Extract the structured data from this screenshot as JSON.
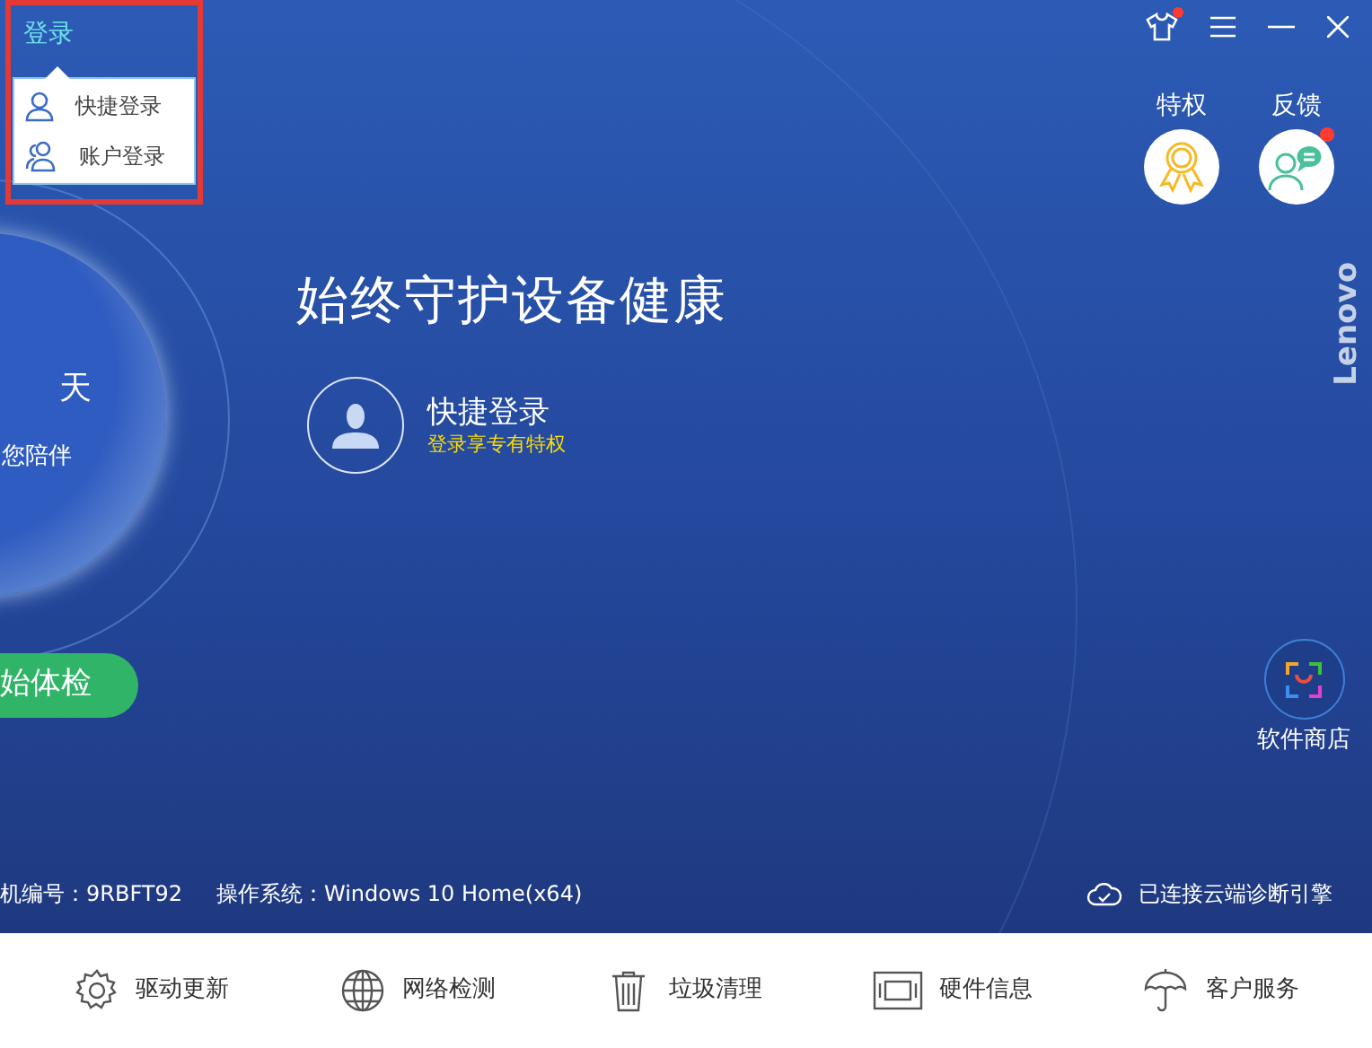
{
  "login": {
    "link": "登录",
    "highlighted": true,
    "menu": [
      {
        "label": "快捷登录",
        "kind": "single"
      },
      {
        "label": "账户登录",
        "kind": "group"
      }
    ]
  },
  "top_controls": {
    "skin_notice": true
  },
  "quick_actions": [
    {
      "label": "特权",
      "kind": "privilege",
      "notice": false
    },
    {
      "label": "反馈",
      "kind": "feedback",
      "notice": true
    }
  ],
  "health": {
    "day_unit": "天",
    "companion": "您陪伴",
    "check_button": "始体检"
  },
  "headline": "始终守护设备健康",
  "login_promo": {
    "title": "快捷登录",
    "subtitle": "登录享专有特权"
  },
  "brand": "Lenovo",
  "store": {
    "label": "软件商店"
  },
  "status": {
    "machine": "机编号：9RBFT92",
    "os": "操作系统：Windows 10 Home(x64)",
    "cloud": "已连接云端诊断引擎"
  },
  "toolbar": [
    {
      "label": "驱动更新",
      "kind": "driver"
    },
    {
      "label": "网络检测",
      "kind": "network"
    },
    {
      "label": "垃圾清理",
      "kind": "trash"
    },
    {
      "label": "硬件信息",
      "kind": "hardware"
    },
    {
      "label": "客户服务",
      "kind": "service"
    }
  ]
}
